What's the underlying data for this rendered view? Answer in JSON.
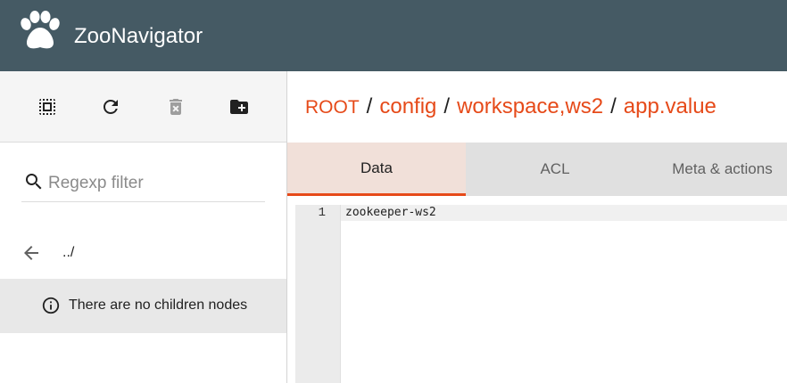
{
  "app": {
    "title": "ZooNavigator",
    "logo_icon": "paw-icon",
    "header_color": "#455a64",
    "accent_color": "#e64a19"
  },
  "toolbar": {
    "buttons": [
      {
        "name": "select-all",
        "icon": "select-all-icon"
      },
      {
        "name": "refresh",
        "icon": "refresh-icon"
      },
      {
        "name": "delete",
        "icon": "delete-icon"
      },
      {
        "name": "create-node",
        "icon": "folder-plus-icon"
      }
    ]
  },
  "sidebar": {
    "filter_placeholder": "Regexp filter",
    "filter_value": "",
    "back_label": "../",
    "empty_message": "There are no children nodes"
  },
  "breadcrumb": {
    "items": [
      "ROOT",
      "config",
      "workspace,ws2",
      "app.value"
    ],
    "separator": "/"
  },
  "tabs": [
    {
      "label": "Data",
      "active": true
    },
    {
      "label": "ACL",
      "active": false
    },
    {
      "label": "Meta & actions",
      "active": false
    }
  ],
  "editor": {
    "lines": [
      {
        "number": "1",
        "text": "zookeeper-ws2"
      }
    ]
  }
}
